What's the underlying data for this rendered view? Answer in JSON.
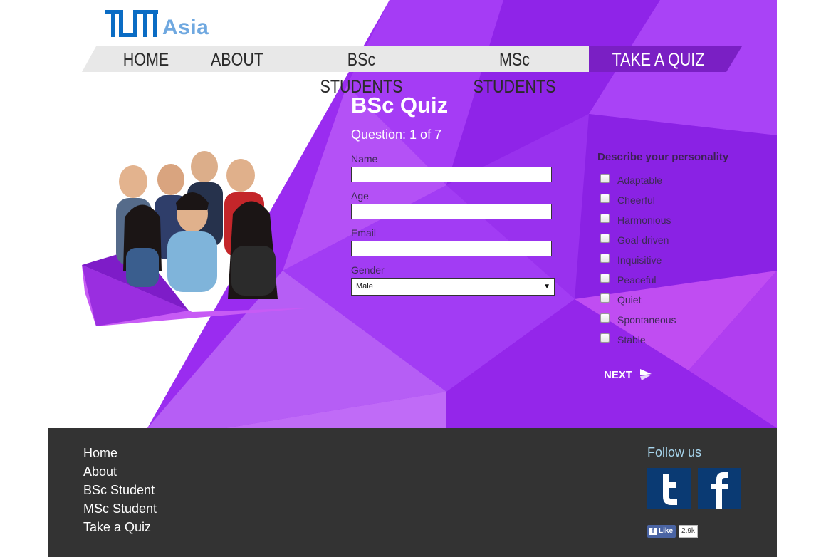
{
  "brand": {
    "logo_text": "Asia"
  },
  "nav": {
    "items": [
      {
        "label": "HOME"
      },
      {
        "label": "ABOUT"
      },
      {
        "label": "BSc STUDENTS"
      },
      {
        "label": "MSc STUDENTS"
      },
      {
        "label": "TAKE A QUIZ",
        "active": true
      }
    ]
  },
  "quiz": {
    "title": "BSc Quiz",
    "question": "Question: 1 of 7",
    "fields": {
      "name_label": "Name",
      "name_value": "",
      "age_label": "Age",
      "age_value": "",
      "email_label": "Email",
      "email_value": "",
      "gender_label": "Gender",
      "gender_value": "Male"
    },
    "personality": {
      "title": "Describe your personality",
      "options": [
        "Adaptable",
        "Cheerful",
        "Harmonious",
        "Goal-driven",
        "Inquisitive",
        "Peaceful",
        "Quiet",
        "Spontaneous",
        "Stable"
      ]
    },
    "next_label": "NEXT"
  },
  "footer": {
    "links": [
      "Home",
      "About",
      "BSc Student",
      "MSc Student",
      "Take a Quiz"
    ],
    "follow_label": "Follow us",
    "fb_like_label": "Like",
    "fb_like_count": "2.9k"
  },
  "colors": {
    "accent_purple": "#9b2ff0",
    "nav_active": "#7a1fc4",
    "footer_bg": "#333333",
    "logo_blue": "#0a6cc4",
    "logo_light_blue": "#6fa8e0",
    "follow_text": "#a8d6ee"
  },
  "icons": {
    "twitter": "twitter-icon",
    "facebook": "facebook-icon",
    "next_arrow": "arrow-right-icon",
    "dropdown": "chevron-down-icon"
  }
}
